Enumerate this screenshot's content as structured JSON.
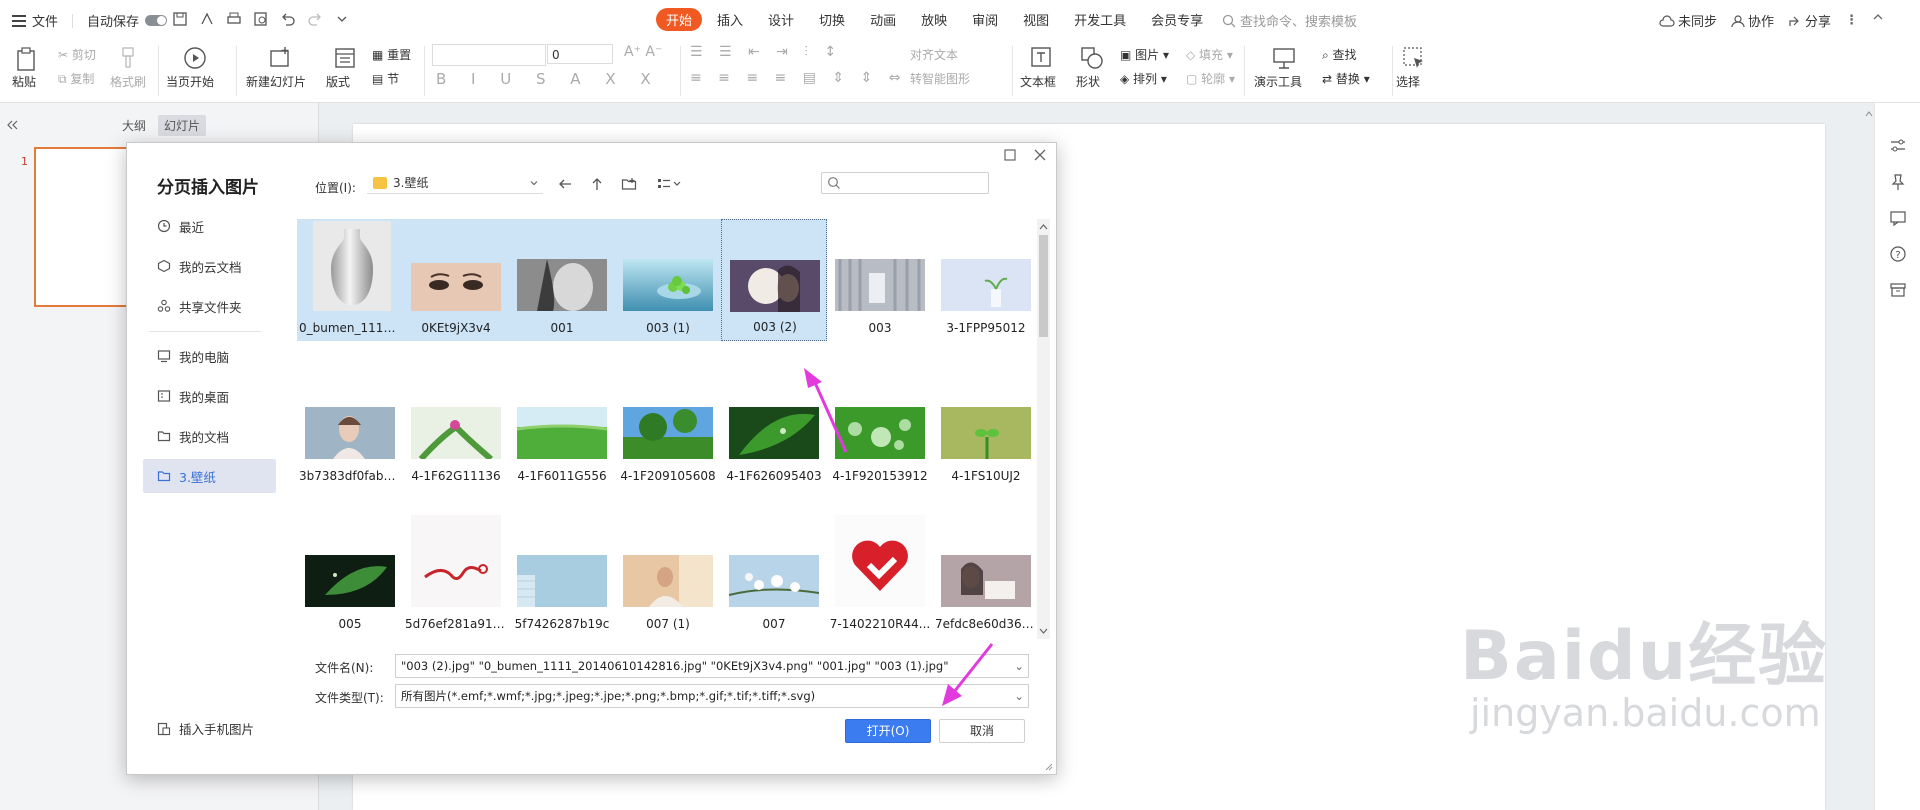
{
  "menubar": {
    "file_label": "文件",
    "autosave_label": "自动保存",
    "tabs": [
      "开始",
      "插入",
      "设计",
      "切换",
      "动画",
      "放映",
      "审阅",
      "视图",
      "开发工具",
      "会员专享"
    ],
    "search_placeholder": "查找命令、搜索模板",
    "right_items": [
      "未同步",
      "协作",
      "分享"
    ]
  },
  "ribbon": {
    "paste": "粘贴",
    "cut": "剪切",
    "copy": "复制",
    "format_painter": "格式刷",
    "play_from_current": "当页开始",
    "new_slide": "新建幻灯片",
    "layout": "版式",
    "reset": "重置",
    "section": "节",
    "font_size": "0",
    "align_text": "对齐文本",
    "smart_graphic": "转智能图形",
    "textbox": "文本框",
    "shapes": "形状",
    "picture": "图片",
    "fill": "填充",
    "arrange": "排列",
    "outline": "轮廓",
    "presentation_tools": "演示工具",
    "find": "查找",
    "replace": "替换",
    "select": "选择"
  },
  "leftpanel": {
    "tab_outline": "大纲",
    "tab_slides": "幻灯片",
    "slide_number": "1"
  },
  "dialog": {
    "title": "分页插入图片",
    "sidebar": [
      {
        "label": "最近",
        "icon": "clock-icon"
      },
      {
        "label": "我的云文档",
        "icon": "cloud-icon"
      },
      {
        "label": "共享文件夹",
        "icon": "share-icon"
      },
      {
        "label": "我的电脑",
        "icon": "computer-icon"
      },
      {
        "label": "我的桌面",
        "icon": "desktop-icon"
      },
      {
        "label": "我的文档",
        "icon": "folder-icon"
      },
      {
        "label": "3.壁纸",
        "icon": "folder-icon"
      }
    ],
    "insert_from_phone": "插入手机图片",
    "location_label": "位置(I):",
    "location_value": "3.壁纸",
    "files": [
      "0_bumen_1111...",
      "0KEt9jX3v4",
      "001",
      "003 (1)",
      "003 (2)",
      "003",
      "3-1FPP95012",
      "3b7383df0fab7...",
      "4-1F62G11136",
      "4-1F6011G556",
      "4-1F209105608",
      "4-1F626095403",
      "4-1F920153912",
      "4-1FS10UJ2",
      "005",
      "5d76ef281a918...",
      "5f7426287b19c",
      "007 (1)",
      "007",
      "7-1402210R44...",
      "7efdc8e60d363..."
    ],
    "filename_label": "文件名(N):",
    "filename_value": "\"003 (2).jpg\" \"0_bumen_1111_20140610142816.jpg\" \"0KEt9jX3v4.png\" \"001.jpg\" \"003 (1).jpg\"",
    "filetype_label": "文件类型(T):",
    "filetype_value": "所有图片(*.emf;*.wmf;*.jpg;*.jpeg;*.jpe;*.png;*.bmp;*.gif;*.tif;*.tiff;*.svg)",
    "open_button": "打开(O)",
    "cancel_button": "取消"
  },
  "watermark": {
    "main": "Baidu经验",
    "sub": "jingyan.baidu.com"
  },
  "colors": {
    "accent_orange": "#f05a22",
    "open_button_blue": "#3b7cf0",
    "selection_blue": "#cde4f7",
    "annotation_magenta": "#e23adc"
  }
}
